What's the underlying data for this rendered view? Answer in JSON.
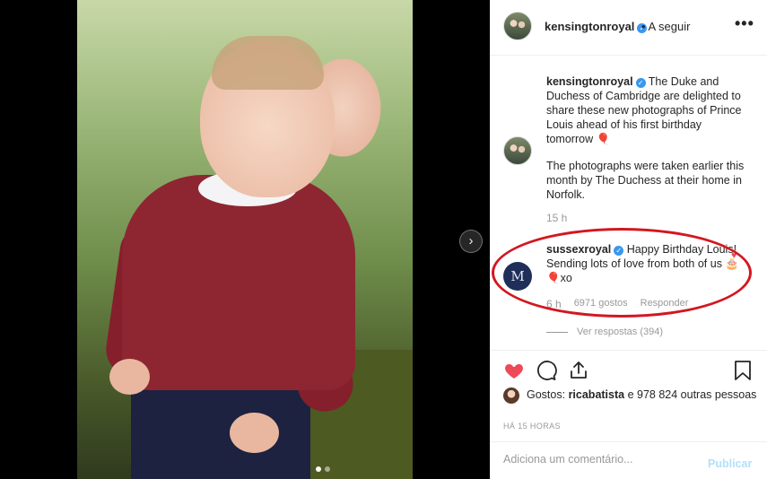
{
  "header": {
    "username": "kensingtonroyal",
    "separator": "•",
    "follow_label": "A seguir",
    "more_icon": "more-options-icon"
  },
  "caption": {
    "username": "kensingtonroyal",
    "text1": "The Duke and Duchess of Cambridge are delighted to share these new photographs of Prince Louis ahead of his first birthday tomorrow 🎈",
    "text2": "The photographs were taken earlier this month by The Duchess at their home in Norfolk.",
    "time": "15 h"
  },
  "comment": {
    "username": "sussexroyal",
    "text": "Happy Birthday Louis! Sending lots of love from both of us 🎂🎈xo",
    "avatar_monogram": "M",
    "time": "6 h",
    "likes": "6971 gostos",
    "reply_label": "Responder",
    "view_replies": "Ver respostas (394)"
  },
  "likes": {
    "prefix": "Gostos:",
    "first_user": "ricabatista",
    "rest": "e 978 824 outras pessoas"
  },
  "posted_ago": "HÁ 15 HORAS",
  "comment_input": {
    "placeholder": "Adiciona um comentário..."
  },
  "post_label": "Publicar",
  "colors": {
    "annotation_oval": "#d3171f",
    "like_heart": "#ed4956",
    "verified": "#3897f0",
    "post_disabled": "#b2dffc"
  }
}
